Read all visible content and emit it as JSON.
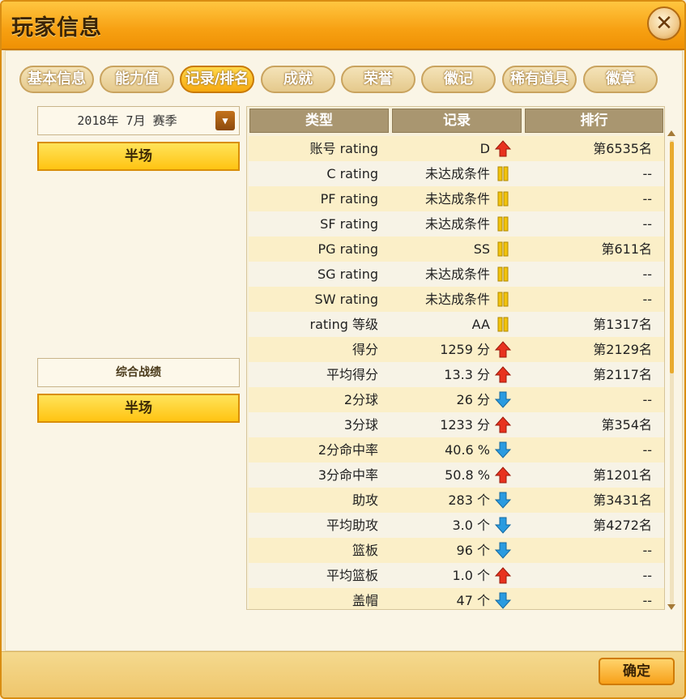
{
  "window": {
    "title": "玩家信息"
  },
  "tabs": [
    {
      "label": "基本信息",
      "active": false
    },
    {
      "label": "能力值",
      "active": false
    },
    {
      "label": "记录/排名",
      "active": true
    },
    {
      "label": "成就",
      "active": false
    },
    {
      "label": "荣誉",
      "active": false
    },
    {
      "label": "徽记",
      "active": false
    },
    {
      "label": "稀有道具",
      "active": false
    },
    {
      "label": "徽章",
      "active": false
    }
  ],
  "left": {
    "season_select": "2018年 7月 赛季",
    "mode_button_1": "半场",
    "overall_label": "综合战绩",
    "mode_button_2": "半场"
  },
  "table": {
    "headers": [
      "类型",
      "记录",
      "排行"
    ],
    "rows": [
      {
        "type": "账号 rating",
        "record": "D",
        "trend": "up",
        "rank": "第6535名"
      },
      {
        "type": "C rating",
        "record": "未达成条件",
        "trend": "none",
        "rank": "--"
      },
      {
        "type": "PF rating",
        "record": "未达成条件",
        "trend": "none",
        "rank": "--"
      },
      {
        "type": "SF rating",
        "record": "未达成条件",
        "trend": "none",
        "rank": "--"
      },
      {
        "type": "PG rating",
        "record": "SS",
        "trend": "none",
        "rank": "第611名"
      },
      {
        "type": "SG rating",
        "record": "未达成条件",
        "trend": "none",
        "rank": "--"
      },
      {
        "type": "SW rating",
        "record": "未达成条件",
        "trend": "none",
        "rank": "--"
      },
      {
        "type": "rating 等级",
        "record": "AA",
        "trend": "none",
        "rank": "第1317名"
      },
      {
        "type": "得分",
        "record": "1259 分",
        "trend": "up",
        "rank": "第2129名"
      },
      {
        "type": "平均得分",
        "record": "13.3 分",
        "trend": "up",
        "rank": "第2117名"
      },
      {
        "type": "2分球",
        "record": "26 分",
        "trend": "down",
        "rank": "--"
      },
      {
        "type": "3分球",
        "record": "1233 分",
        "trend": "up",
        "rank": "第354名"
      },
      {
        "type": "2分命中率",
        "record": "40.6 %",
        "trend": "down",
        "rank": "--"
      },
      {
        "type": "3分命中率",
        "record": "50.8 %",
        "trend": "up",
        "rank": "第1201名"
      },
      {
        "type": "助攻",
        "record": "283 个",
        "trend": "down",
        "rank": "第3431名"
      },
      {
        "type": "平均助攻",
        "record": "3.0 个",
        "trend": "down",
        "rank": "第4272名"
      },
      {
        "type": "篮板",
        "record": "96 个",
        "trend": "down",
        "rank": "--"
      },
      {
        "type": "平均篮板",
        "record": "1.0 个",
        "trend": "up",
        "rank": "--"
      },
      {
        "type": "盖帽",
        "record": "47 个",
        "trend": "down",
        "rank": "--"
      }
    ]
  },
  "icons": {
    "up": "trend-up-icon",
    "down": "trend-down-icon",
    "none": "no-change-icon"
  },
  "colors": {
    "up": "#e8321e",
    "down": "#2a9be0",
    "none": "#f2c30c"
  },
  "footer": {
    "ok_label": "确定"
  }
}
